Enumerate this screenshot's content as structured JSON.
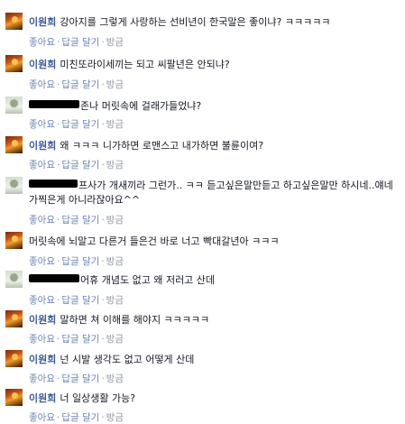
{
  "action_labels": {
    "like": "좋아요",
    "reply": "답글 달기",
    "time": "방금",
    "separator": "·"
  },
  "comments": [
    {
      "name": "이원희",
      "text": "강아지를 그렇게 사랑하는 선비년이 한국말은 좋이냐? ㅋㅋㅋㅋㅋ"
    },
    {
      "name": "이원희",
      "text": "미친또라이세끼는 되고 씨팔년은 안되냐?"
    },
    {
      "name": "",
      "text": "존나 머릿속에 걸래가들었냐?"
    },
    {
      "name": "이원희",
      "text": "왜 ㅋㅋㅋ 니가하면 로맨스고 내가하면 불륜이여?"
    },
    {
      "name": "",
      "text": "프사가 개새끼라 그런가.. ㅋㅋ 듣고싶은말만듣고 하고싶은말만 하시네..얘네가찍은게 아니라잖아요^^"
    },
    {
      "name": "이원희",
      "text": "머릿속에 뇌말고 다른거 들은건 바로 너고 빡대갈년아 ㅋㅋㅋ"
    },
    {
      "name": "",
      "text": "어휴 개념도 없고 왜 저러고 산데"
    },
    {
      "name": "이원희",
      "text": "말하면 쳐 이해를 해야지 ㅋㅋㅋㅋㅋ"
    },
    {
      "name": "이원희",
      "text": "넌 시발 생각도 없고 어떻게 산데"
    },
    {
      "name": "이원희",
      "text": "너 일상생활 가능?"
    }
  ]
}
